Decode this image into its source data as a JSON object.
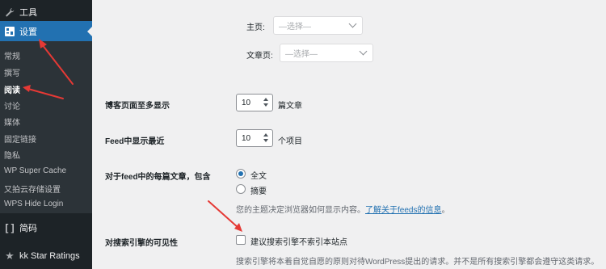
{
  "sidebar": {
    "tools": "工具",
    "settings": "设置",
    "submenu": [
      "常规",
      "撰写",
      "阅读",
      "讨论",
      "媒体",
      "固定链接",
      "隐私",
      "WP Super Cache",
      "又拍云存储设置",
      "WPS Hide Login"
    ],
    "current": "阅读",
    "posts": "简码",
    "kk_star": "kk Star Ratings"
  },
  "main": {
    "homepage_label": "主页:",
    "homepage_select": "—选择—",
    "postspage_label": "文章页:",
    "postspage_select": "—选择—",
    "blog_pages_label": "博客页面至多显示",
    "blog_pages_value": "10",
    "blog_pages_suffix": "篇文章",
    "feed_label": "Feed中显示最近",
    "feed_value": "10",
    "feed_suffix": "个项目",
    "feed_each_label": "对于feed中的每篇文章，包含",
    "radio_full": "全文",
    "radio_summary": "摘要",
    "theme_desc": "您的主题决定浏览器如何显示内容。",
    "feeds_link": "了解关于feeds的信息",
    "feeds_link_tail": "。",
    "search_label": "对搜索引擎的可见性",
    "search_checkbox": "建议搜索引擎不索引本站点",
    "search_desc": "搜索引擎将本着自觉自愿的原则对待WordPress提出的请求。并不是所有搜索引擎都会遵守这类请求。"
  },
  "icons": {
    "tools": "wrench-icon",
    "settings": "settings-icon",
    "posts": "shortcode-icon",
    "kk_star": "star-icon"
  },
  "colors": {
    "sidebar_bg": "#1d2327",
    "active_bg": "#2271b1",
    "annotation": "#e53935",
    "link": "#2271b1"
  }
}
